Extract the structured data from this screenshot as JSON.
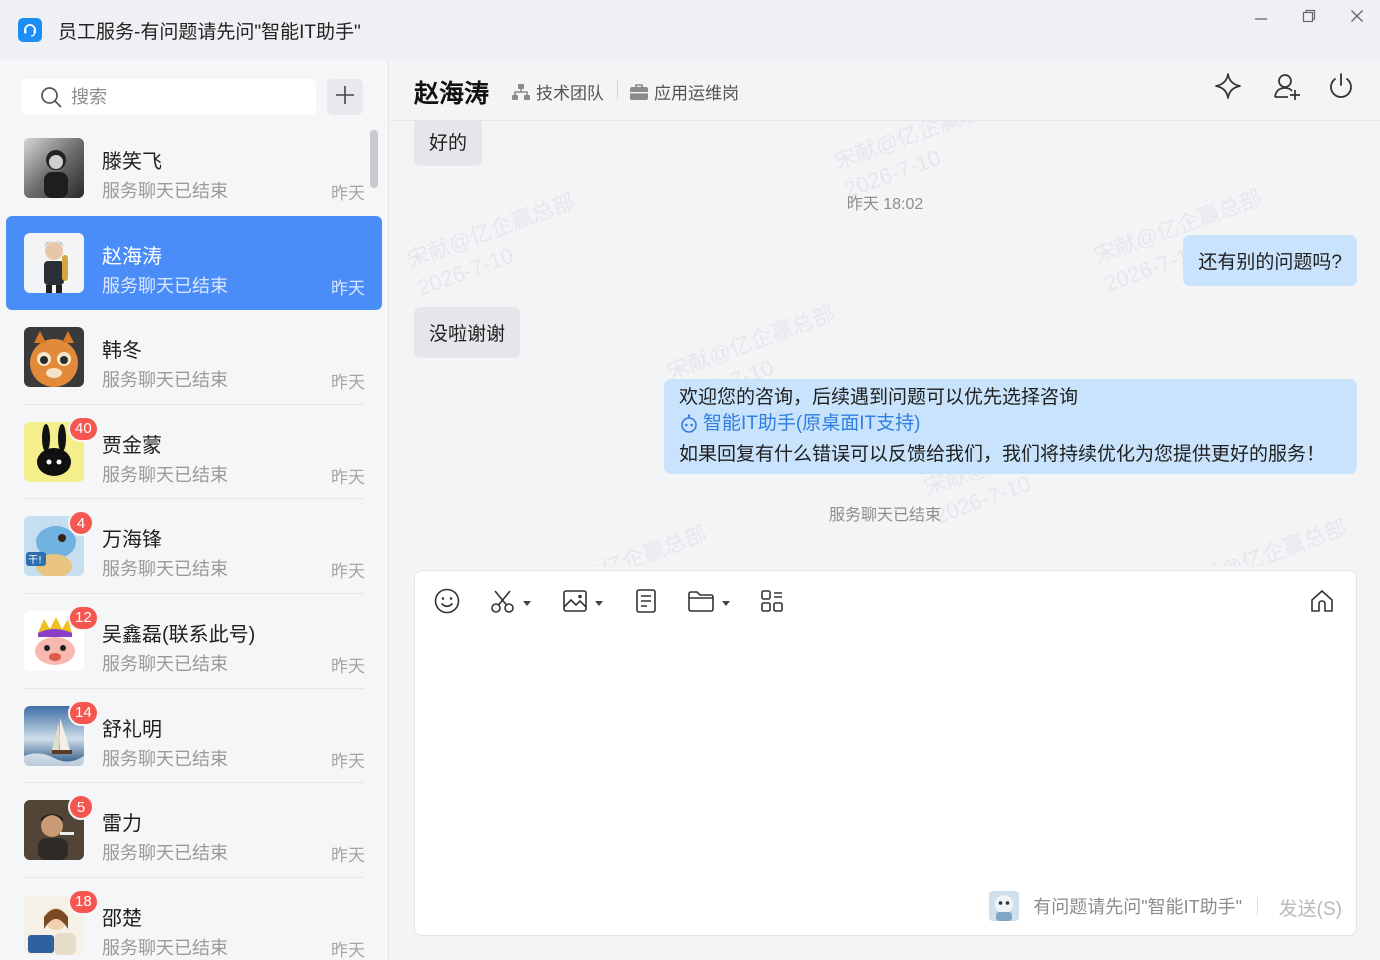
{
  "window": {
    "title": "员工服务-有问题请先问\"智能IT助手\"",
    "controls": [
      "minimize",
      "restore",
      "close"
    ]
  },
  "sidebar": {
    "search_placeholder": "搜索",
    "conversations": [
      {
        "name": "滕笑飞",
        "last": "服务聊天已结束",
        "time": "昨天",
        "badge": ""
      },
      {
        "name": "赵海涛",
        "last": "服务聊天已结束",
        "time": "昨天",
        "badge": "",
        "active": true
      },
      {
        "name": "韩冬",
        "last": "服务聊天已结束",
        "time": "昨天",
        "badge": ""
      },
      {
        "name": "贾金蒙",
        "last": "服务聊天已结束",
        "time": "昨天",
        "badge": "40"
      },
      {
        "name": "万海锋",
        "last": "服务聊天已结束",
        "time": "昨天",
        "badge": "4"
      },
      {
        "name": "吴鑫磊(联系此号)",
        "last": "服务聊天已结束",
        "time": "昨天",
        "badge": "12"
      },
      {
        "name": "舒礼明",
        "last": "服务聊天已结束",
        "time": "昨天",
        "badge": "14"
      },
      {
        "name": "雷力",
        "last": "服务聊天已结束",
        "time": "昨天",
        "badge": "5"
      },
      {
        "name": "邵楚",
        "last": "服务聊天已结束",
        "time": "昨天",
        "badge": "18"
      }
    ]
  },
  "header": {
    "name": "赵海涛",
    "team": "技术团队",
    "role": "应用运维岗"
  },
  "chat": {
    "watermark": "宋献@亿企赢总部\n2026-7-10",
    "messages": {
      "m1": "好的",
      "ts": "昨天 18:02",
      "m2": "还有别的问题吗?",
      "m3": "没啦谢谢",
      "m4_line1": "欢迎您的咨询，后续遇到问题可以优先选择咨询",
      "m4_link": "智能IT助手(原桌面IT支持)",
      "m4_line3": "如果回复有什么错误可以反馈给我们，我们将持续优化为您提供更好的服务！",
      "ended": "服务聊天已结束"
    }
  },
  "composer": {
    "hint": "有问题请先问\"智能IT助手\"",
    "send_label": "发送(S)"
  },
  "colors": {
    "accent": "#4b8df8",
    "badge": "#f5564f",
    "outgoing_bubble": "#c8e3fb",
    "incoming_bubble": "#e5e6e9",
    "link": "#2f7fe0"
  }
}
